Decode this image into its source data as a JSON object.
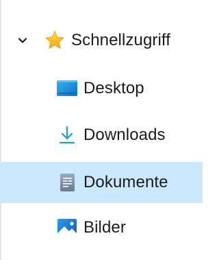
{
  "nav": {
    "quick_access": {
      "label": "Schnellzugriff",
      "icon": "star-icon",
      "expanded": true,
      "children": [
        {
          "label": "Desktop",
          "icon": "desktop-icon",
          "selected": false
        },
        {
          "label": "Downloads",
          "icon": "download-icon",
          "selected": false
        },
        {
          "label": "Dokumente",
          "icon": "documents-icon",
          "selected": true
        },
        {
          "label": "Bilder",
          "icon": "pictures-icon",
          "selected": false
        }
      ]
    }
  },
  "colors": {
    "selected_background": "#cce8ff",
    "star": "#f8c326",
    "desktop": "#1a8ad8",
    "download_arrow": "#1a9fd0",
    "documents": "#7b8fa6",
    "pictures": "#1675d2"
  }
}
